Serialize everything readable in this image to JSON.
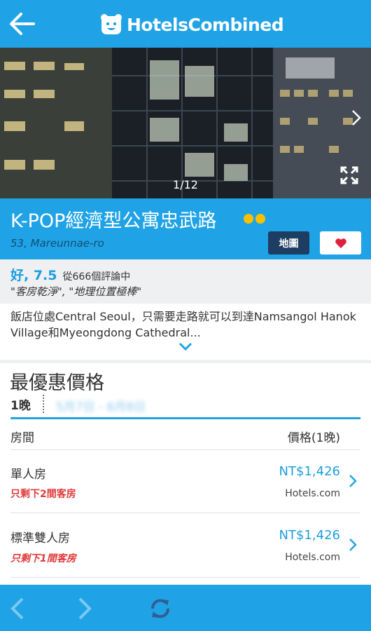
{
  "app": {
    "brand_bold": "Hotels",
    "brand_rest": "Combined"
  },
  "gallery": {
    "counter": "1/12"
  },
  "hotel": {
    "name": "K-POP經濟型公寓忠武路",
    "star_rating": 2,
    "address": "53, Mareunnae-ro",
    "map_label": "地圖"
  },
  "rating": {
    "score": "好, 7.5",
    "count": "從666個評論中",
    "quote": "\"客房乾淨\", \"地理位置極棒\""
  },
  "description": "飯店位處Central Seoul，只需要走路就可以到達Namsangol Hanok Village和Myeongdong Cathedral...",
  "deals": {
    "title": "最優惠價格",
    "nights": "1晚",
    "dates": "5月7日 - 6月8日",
    "col_room": "房間",
    "col_price": "價格(1晚)",
    "rooms": [
      {
        "name": "單人房",
        "availability": "只剩下2間客房",
        "price": "NT$1,426",
        "source": "Hotels.com"
      },
      {
        "name": "標準雙人房",
        "availability": "只剩下1間客房",
        "price": "NT$1,426",
        "source": "Hotels.com"
      }
    ]
  },
  "colors": {
    "brand_blue": "#20a3e6",
    "price_blue": "#1d9de0",
    "alert_red": "#e03a3a",
    "map_button": "#1d3e62",
    "star_yellow": "#f7c000"
  },
  "icons": {
    "back": "arrow-left-icon",
    "logo": "bear-logo-icon",
    "gallery_next": "chevron-right-icon",
    "fullscreen": "expand-icon",
    "favorite": "heart-icon",
    "expand_description": "chevron-down-icon",
    "row": "chevron-right-icon",
    "nav_back": "chevron-left-icon",
    "nav_forward": "chevron-right-icon",
    "refresh": "refresh-icon"
  }
}
